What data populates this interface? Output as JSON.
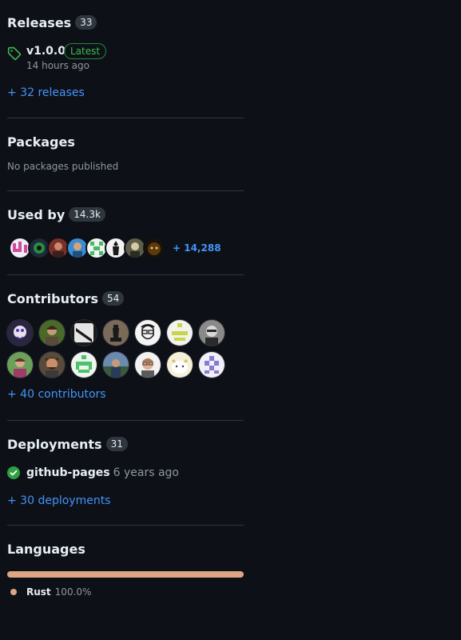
{
  "colors": {
    "background": "#0d1117",
    "link": "#4493f8",
    "latest_badge": "#3fb950",
    "success": "#2ea043",
    "rust": "#dea584"
  },
  "releases": {
    "title": "Releases",
    "count": "33",
    "latest": {
      "tag": "v1.0.0",
      "badge": "Latest",
      "time": "14 hours ago",
      "icon": "tag-icon"
    },
    "more_link": "+ 32 releases"
  },
  "packages": {
    "title": "Packages",
    "empty_text": "No packages published"
  },
  "used_by": {
    "title": "Used by",
    "count": "14.3k",
    "avatar_count": 8,
    "more_link": "+ 14,288"
  },
  "contributors": {
    "title": "Contributors",
    "count": "54",
    "avatar_count": 14,
    "more_link": "+ 40 contributors"
  },
  "deployments": {
    "title": "Deployments",
    "count": "31",
    "latest": {
      "environment": "github-pages",
      "time": "6 years ago",
      "status_icon": "check-circle-icon"
    },
    "more_link": "+ 30 deployments"
  },
  "languages": {
    "title": "Languages",
    "items": [
      {
        "name": "Rust",
        "percent_label": "100.0%",
        "percent": 100.0,
        "color": "#dea584"
      }
    ]
  }
}
